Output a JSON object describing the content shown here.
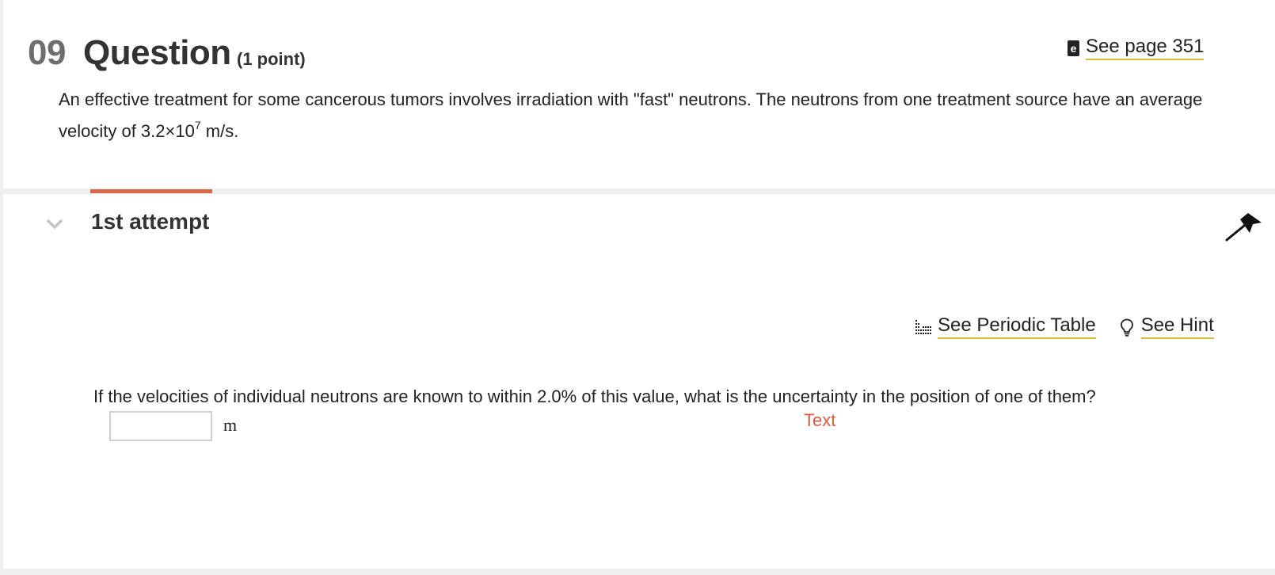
{
  "question": {
    "number": "09",
    "title": "Question",
    "points": "(1 point)",
    "ebook_link": "See page 351",
    "ebook_icon": "ebook-icon",
    "intro_main": "An effective treatment for some cancerous tumors involves irradiation with \"fast\" neutrons. The neutrons from one treatment source have an average velocity of 3.2×10",
    "intro_exponent": "7",
    "intro_tail": " m/s."
  },
  "attempt": {
    "label": "1st attempt",
    "accent_color": "#d9684a",
    "tools": [
      {
        "label": "See Periodic Table",
        "icon": "periodic-table-icon"
      },
      {
        "label": "See Hint",
        "icon": "lightbulb-icon"
      }
    ],
    "prompt": "If the velocities of individual neutrons are known to within 2.0% of this value, what is the uncertainty in the position of one of them?",
    "answer": {
      "value": "",
      "placeholder": ""
    },
    "unit": "m",
    "annotation": "Text",
    "annotation_color": "#e05a3e"
  },
  "colors": {
    "link_underline": "#d8b93a",
    "number_gray": "#6e6e6e"
  }
}
